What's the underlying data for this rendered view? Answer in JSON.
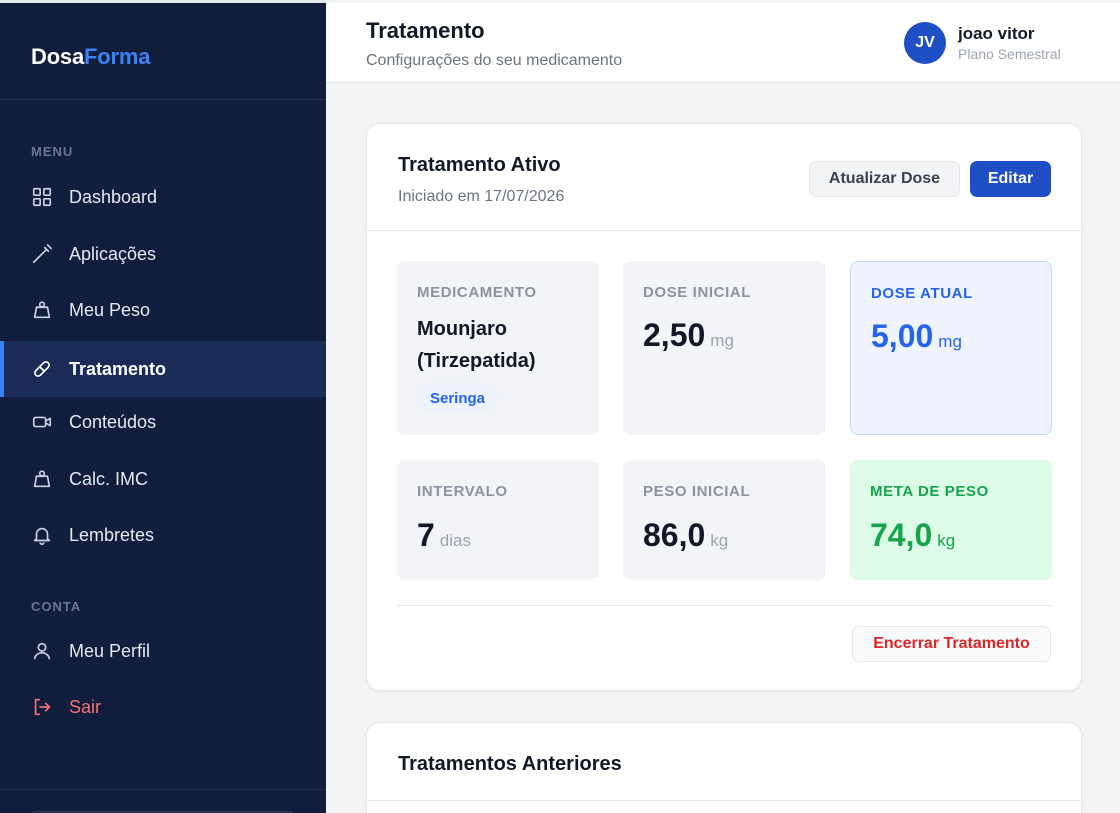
{
  "brand": {
    "part1": "Dosa",
    "part2": "Forma"
  },
  "sidebar": {
    "menu_label": "MENU",
    "account_label": "CONTA",
    "items": [
      {
        "label": "Dashboard",
        "icon": "grid-icon"
      },
      {
        "label": "Aplicações",
        "icon": "syringe-icon"
      },
      {
        "label": "Meu Peso",
        "icon": "weight-icon"
      },
      {
        "label": "Tratamento",
        "icon": "pill-icon",
        "active": true
      },
      {
        "label": "Conteúdos",
        "icon": "video-icon"
      },
      {
        "label": "Calc. IMC",
        "icon": "weight-icon"
      },
      {
        "label": "Lembretes",
        "icon": "bell-icon"
      }
    ],
    "account_items": [
      {
        "label": "Meu Perfil",
        "icon": "user-icon"
      },
      {
        "label": "Sair",
        "icon": "logout-icon"
      }
    ]
  },
  "header": {
    "title": "Tratamento",
    "subtitle": "Configurações do seu medicamento",
    "user": {
      "initials": "JV",
      "name": "joao vitor",
      "plan": "Plano Semestral"
    }
  },
  "active_treatment": {
    "title": "Tratamento Ativo",
    "started": "Iniciado em 17/07/2026",
    "update_button": "Atualizar Dose",
    "edit_button": "Editar",
    "end_button": "Encerrar Tratamento",
    "medication": {
      "label": "MEDICAMENTO",
      "line1": "Mounjaro",
      "line2": "(Tirzepatida)",
      "chip": "Seringa"
    },
    "initial_dose": {
      "label": "DOSE INICIAL",
      "value": "2,50",
      "unit": "mg"
    },
    "current_dose": {
      "label": "DOSE ATUAL",
      "value": "5,00",
      "unit": "mg"
    },
    "interval": {
      "label": "INTERVALO",
      "value": "7",
      "unit": "dias"
    },
    "initial_weight": {
      "label": "PESO INICIAL",
      "value": "86,0",
      "unit": "kg"
    },
    "target_weight": {
      "label": "META DE PESO",
      "value": "74,0",
      "unit": "kg"
    }
  },
  "previous": {
    "title": "Tratamentos Anteriores"
  },
  "colors": {
    "sidebar": "#111d3c",
    "accent": "#3b82f6",
    "primary": "#1e4fc4",
    "danger": "#dc2626",
    "success": "#16a34a"
  }
}
